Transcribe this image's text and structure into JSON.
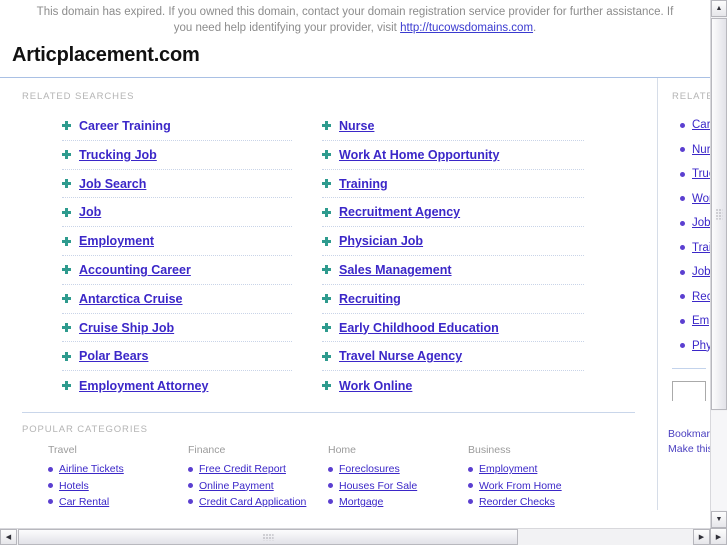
{
  "notice": {
    "text_before_link": "This domain has expired. If you owned this domain, contact your domain registration service provider for further assistance. If you need help identifying your provider, visit ",
    "link_text": "http://tucowsdomains.com",
    "text_after_link": "."
  },
  "brand": {
    "domain": "Articplacement.com"
  },
  "main": {
    "related_searches_label": "RELATED SEARCHES",
    "column_left": [
      "Career Training",
      "Trucking Job",
      "Job Search",
      "Job",
      "Employment",
      "Accounting Career",
      "Antarctica Cruise",
      "Cruise Ship Job",
      "Polar Bears",
      "Employment Attorney"
    ],
    "column_right": [
      "Nurse",
      "Work At Home Opportunity",
      "Training",
      "Recruitment Agency",
      "Physician Job",
      "Sales Management",
      "Recruiting",
      "Early Childhood Education",
      "Travel Nurse Agency",
      "Work Online"
    ]
  },
  "sidebar": {
    "related_label": "RELATED",
    "items": [
      "Career Training",
      "Nurse",
      "Trucking Job",
      "Work At Home Opportunity",
      "Job Search",
      "Training",
      "Job",
      "Recruitment Agency",
      "Employment",
      "Physician Job"
    ],
    "search_value": "",
    "search_placeholder": "",
    "footer_line1": "Bookmark",
    "footer_line2": "Make this"
  },
  "categories": {
    "label": "POPULAR CATEGORIES",
    "groups": [
      {
        "title": "Travel",
        "items": [
          "Airline Tickets",
          "Hotels",
          "Car Rental"
        ]
      },
      {
        "title": "Finance",
        "items": [
          "Free Credit Report",
          "Online Payment",
          "Credit Card Application"
        ]
      },
      {
        "title": "Home",
        "items": [
          "Foreclosures",
          "Houses For Sale",
          "Mortgage"
        ]
      },
      {
        "title": "Business",
        "items": [
          "Employment",
          "Work From Home",
          "Reorder Checks"
        ]
      }
    ]
  },
  "scrollbars": {
    "up_arrow": "▲",
    "down_arrow": "▼",
    "left_arrow": "◀",
    "right_arrow": "▶",
    "corner_arrow": "▶"
  },
  "colors": {
    "link": "#3b27c8",
    "notice_text": "#8c8c8c",
    "arrow_marker": "#2e9b8e",
    "rule": "#a9c0e4"
  }
}
